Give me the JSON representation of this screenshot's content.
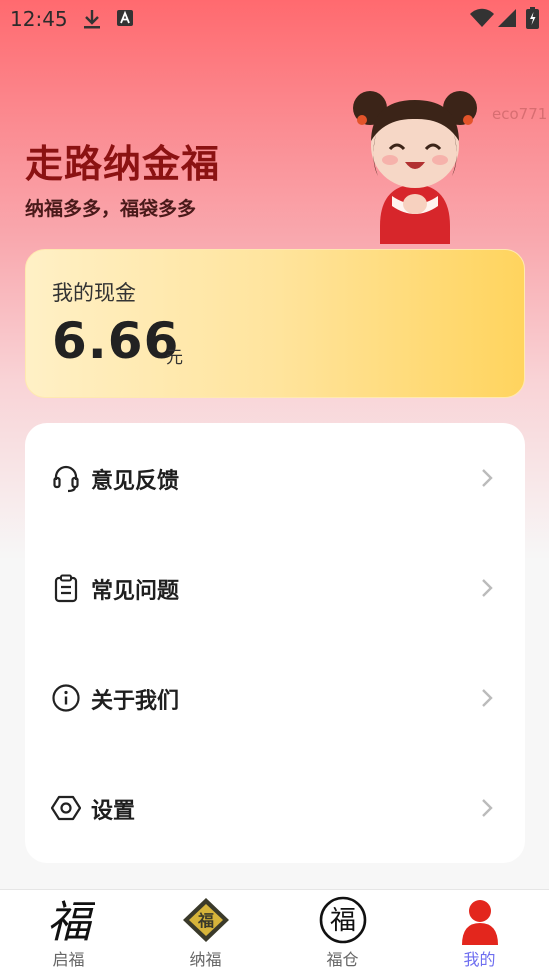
{
  "status_bar": {
    "time": "12:45",
    "icons": [
      "download-icon",
      "font-a-icon",
      "wifi-icon",
      "signal-icon",
      "battery-icon"
    ]
  },
  "hero": {
    "title": "走路纳金福",
    "subtitle": "纳福多多，福袋多多",
    "watermark": "eco771"
  },
  "cash": {
    "label": "我的现金",
    "amount": "6.66",
    "unit": "元"
  },
  "menu": [
    {
      "label": "意见反馈",
      "icon": "headset-icon"
    },
    {
      "label": "常见问题",
      "icon": "clipboard-icon"
    },
    {
      "label": "关于我们",
      "icon": "info-icon"
    },
    {
      "label": "设置",
      "icon": "settings-hex-icon"
    }
  ],
  "tabs": [
    {
      "label": "启福",
      "icon": "calligraphy-fu-icon",
      "active": false
    },
    {
      "label": "纳福",
      "icon": "diamond-fu-icon",
      "active": false
    },
    {
      "label": "福仓",
      "icon": "circle-fu-icon",
      "active": false
    },
    {
      "label": "我的",
      "icon": "person-icon",
      "active": true
    }
  ],
  "colors": {
    "accent": "#e3261d",
    "tab_active": "#6e6ef0",
    "title": "#8b1212"
  }
}
